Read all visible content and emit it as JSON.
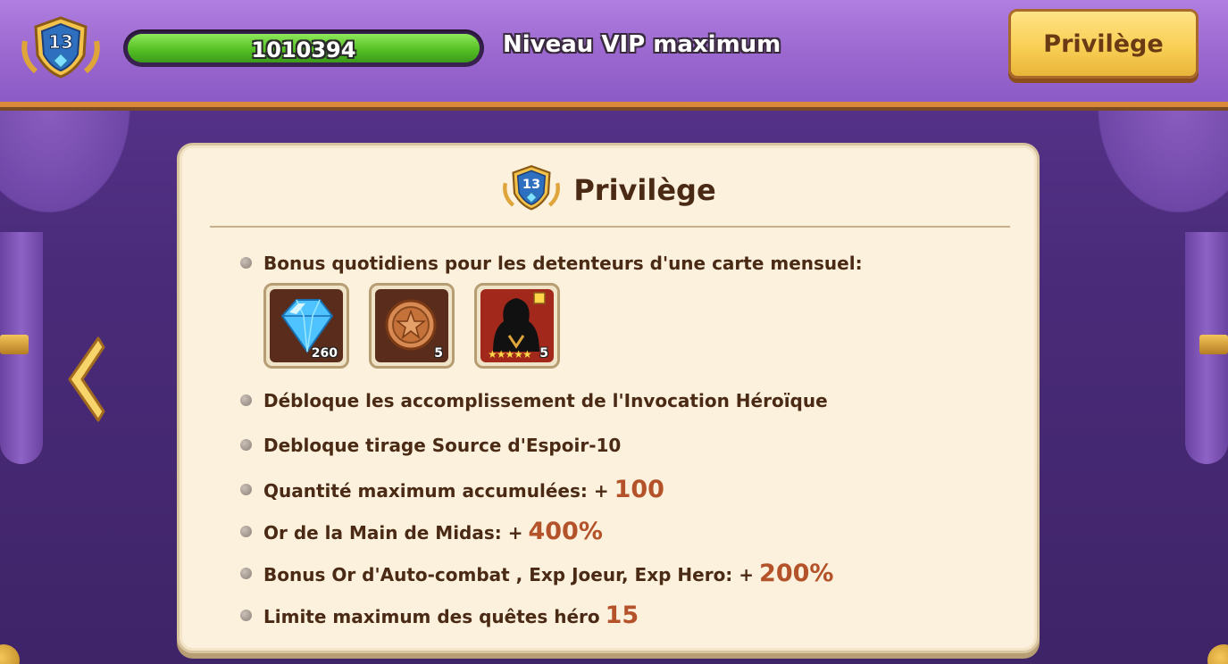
{
  "header": {
    "vip_level": "13",
    "progress_value": "1010394",
    "progress_fraction": 1.0,
    "vip_status": "Niveau VIP maximum",
    "privilege_button": "Privilège"
  },
  "panel": {
    "title": "Privilège",
    "badge_level": "13",
    "items": [
      {
        "text": "Bonus quotidiens pour les detenteurs d'une carte mensuel:",
        "value": ""
      },
      {
        "text": "Débloque les accomplissement de l'Invocation Héroïque",
        "value": ""
      },
      {
        "text": "Debloque tirage Source d'Espoir-10",
        "value": ""
      },
      {
        "text": "Quantité maximum accumulées: +",
        "value": "100"
      },
      {
        "text": "Or de la Main de Midas: +",
        "value": "400%"
      },
      {
        "text": "Bonus Or d'Auto-combat , Exp Joeur, Exp Hero: +",
        "value": "200%"
      },
      {
        "text": "Limite maximum des quêtes héro",
        "value": "15"
      }
    ],
    "rewards": [
      {
        "icon": "diamond-icon",
        "count": "260"
      },
      {
        "icon": "bronze-coin-icon",
        "count": "5"
      },
      {
        "icon": "hero-silhouette-icon",
        "count": "5",
        "stars": "★★★★★"
      }
    ]
  },
  "colors": {
    "header_bg": "#9a67cf",
    "panel_bg": "#fbf1dd",
    "value_accent": "#b4522a",
    "button_gold": "#f9cf55",
    "progress_green": "#55c025"
  }
}
